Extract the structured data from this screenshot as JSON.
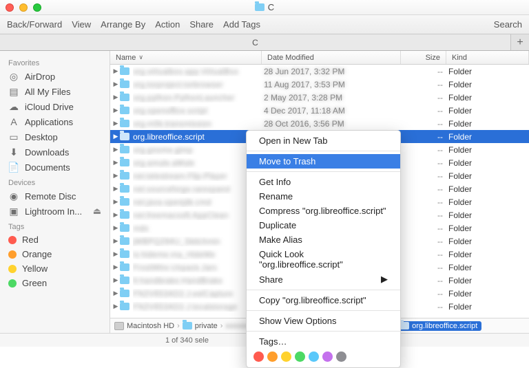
{
  "window": {
    "title": "C"
  },
  "toolbar": {
    "backforward": "Back/Forward",
    "view": "View",
    "arrange": "Arrange By",
    "action": "Action",
    "share": "Share",
    "addtags": "Add Tags",
    "search": "Search"
  },
  "tab": {
    "label": "C",
    "plus": "+"
  },
  "sidebar": {
    "favorites_head": "Favorites",
    "favorites": [
      {
        "label": "AirDrop",
        "icon": "◎"
      },
      {
        "label": "All My Files",
        "icon": "▤"
      },
      {
        "label": "iCloud Drive",
        "icon": "☁"
      },
      {
        "label": "Applications",
        "icon": "A"
      },
      {
        "label": "Desktop",
        "icon": "▭"
      },
      {
        "label": "Downloads",
        "icon": "⬇"
      },
      {
        "label": "Documents",
        "icon": "📄"
      }
    ],
    "devices_head": "Devices",
    "devices": [
      {
        "label": "Remote Disc",
        "icon": "◉"
      },
      {
        "label": "Lightroom In...",
        "icon": "▣",
        "eject": "⏏"
      }
    ],
    "tags_head": "Tags",
    "tags": [
      {
        "label": "Red",
        "color": "#ff5b4f"
      },
      {
        "label": "Orange",
        "color": "#ff9e2c"
      },
      {
        "label": "Yellow",
        "color": "#ffd22e"
      },
      {
        "label": "Green",
        "color": "#4cd964"
      }
    ]
  },
  "columns": {
    "name": "Name",
    "date": "Date Modified",
    "size": "Size",
    "kind": "Kind"
  },
  "rows": [
    {
      "name": "org.virtualbox.app.VirtualBox",
      "date": "28 Jun 2017, 3:32 PM",
      "size": "--",
      "kind": "Folder",
      "blur": true
    },
    {
      "name": "org.torproject.torbrowser",
      "date": "11 Aug 2017, 3:53 PM",
      "size": "--",
      "kind": "Folder",
      "blur": true
    },
    {
      "name": "org.python.PythonLauncher",
      "date": "2 May 2017, 3:28 PM",
      "size": "--",
      "kind": "Folder",
      "blur": true
    },
    {
      "name": "org.openoffice.script",
      "date": "4 Dec 2017, 11:18 AM",
      "size": "--",
      "kind": "Folder",
      "blur": true
    },
    {
      "name": "org.m0k.transmission",
      "date": "28 Oct 2016, 3:56 PM",
      "size": "--",
      "kind": "Folder",
      "blur": true
    },
    {
      "name": "org.libreoffice.script",
      "date": "",
      "size": "--",
      "kind": "Folder",
      "selected": true
    },
    {
      "name": "org.gnome.gimp",
      "date": "",
      "size": "--",
      "kind": "Folder",
      "blur": true
    },
    {
      "name": "org.amule.aMule",
      "date": "",
      "size": "--",
      "kind": "Folder",
      "blur": true
    },
    {
      "name": "net.telestream.Flip-Player",
      "date": "",
      "size": "--",
      "kind": "Folder",
      "blur": true
    },
    {
      "name": "net.sourceforge.rarexpand",
      "date": "",
      "size": "--",
      "kind": "Folder",
      "blur": true
    },
    {
      "name": "net.java.openjdk.cmd",
      "date": "",
      "size": "--",
      "kind": "Folder",
      "blur": true
    },
    {
      "name": "net.freemacsoft.AppClean",
      "date": "",
      "size": "--",
      "kind": "Folder",
      "blur": true
    },
    {
      "name": "mdx",
      "date": "",
      "size": "--",
      "kind": "Folder",
      "blur": true
    },
    {
      "name": "jWBPQ294U_Skitchmin",
      "date": "",
      "size": "--",
      "kind": "Folder",
      "blur": true
    },
    {
      "name": "is.hideme.ma_HideMe",
      "date": "",
      "size": "--",
      "kind": "Folder",
      "blur": true
    },
    {
      "name": "FrostWire.Unpack.Jars",
      "date": "",
      "size": "--",
      "kind": "Folder",
      "blur": true
    },
    {
      "name": "fr.handbrake.HandBrake",
      "date": "",
      "size": "--",
      "kind": "Folder",
      "blur": true
    },
    {
      "name": "FN2V653AD2.J.eelCapture",
      "date": "",
      "size": "--",
      "kind": "Folder",
      "blur": true
    },
    {
      "name": "FN2V653AD2.J.localstorage",
      "date": "",
      "size": "--",
      "kind": "Folder",
      "blur": true
    }
  ],
  "contextmenu": {
    "open_new_tab": "Open in New Tab",
    "move_trash": "Move to Trash",
    "get_info": "Get Info",
    "rename": "Rename",
    "compress": "Compress \"org.libreoffice.script\"",
    "duplicate": "Duplicate",
    "make_alias": "Make Alias",
    "quick_look": "Quick Look \"org.libreoffice.script\"",
    "share": "Share",
    "copy": "Copy \"org.libreoffice.script\"",
    "show_view": "Show View Options",
    "tags": "Tags…",
    "tag_colors": [
      "#ff5b4f",
      "#ff9e2c",
      "#ffd22e",
      "#4cd964",
      "#5ac8fa",
      "#c471ed",
      "#8e8e93"
    ]
  },
  "pathbar": {
    "root": "Macintosh HD",
    "seg1": "private",
    "current": "org.libreoffice.script"
  },
  "status": "1 of 340 sele"
}
